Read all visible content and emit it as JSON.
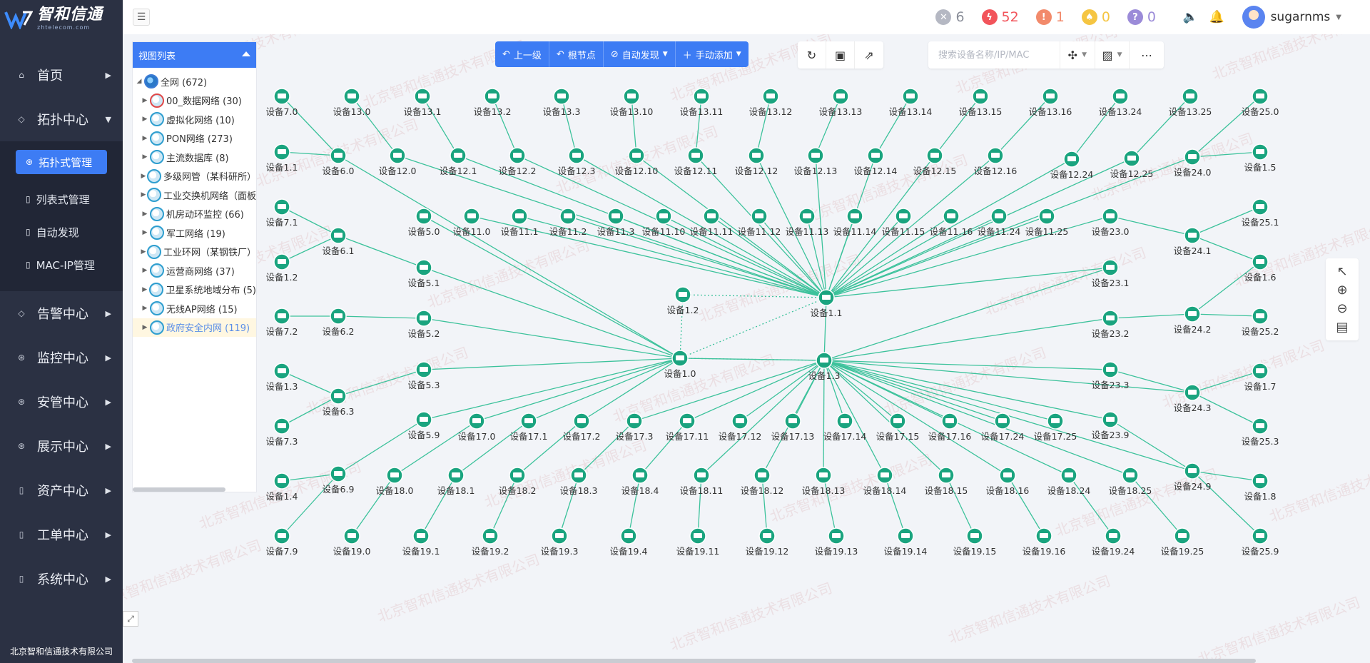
{
  "app": {
    "brand": "智和信通",
    "brand_sub": "zhtelecom.com",
    "company": "北京智和信通技术有限公司",
    "watermark": "北京智和信通技术有限公司"
  },
  "nav": {
    "items": [
      {
        "label": "首页",
        "icon": "home-icon"
      },
      {
        "label": "拓扑中心",
        "icon": "topology-icon",
        "expanded": true
      },
      {
        "label": "告警中心",
        "icon": "alarm-icon"
      },
      {
        "label": "监控中心",
        "icon": "monitor-icon"
      },
      {
        "label": "安管中心",
        "icon": "security-icon"
      },
      {
        "label": "展示中心",
        "icon": "display-icon"
      },
      {
        "label": "资产中心",
        "icon": "asset-icon"
      },
      {
        "label": "工单中心",
        "icon": "ticket-icon"
      },
      {
        "label": "系统中心",
        "icon": "system-icon"
      }
    ],
    "sub_items": [
      {
        "label": "拓扑式管理",
        "active": true
      },
      {
        "label": "列表式管理"
      },
      {
        "label": "自动发现"
      },
      {
        "label": "MAC-IP管理"
      }
    ]
  },
  "header": {
    "badges": [
      {
        "value": "6",
        "color": "#b5b8c3",
        "glyph": "✕"
      },
      {
        "value": "52",
        "color": "#f2545b",
        "glyph": "ϟ"
      },
      {
        "value": "1",
        "color": "#f28a6b",
        "glyph": "!"
      },
      {
        "value": "0",
        "color": "#f5c542",
        "glyph": "♠"
      },
      {
        "value": "0",
        "color": "#9b8bd8",
        "glyph": "?"
      }
    ],
    "username": "sugarnms"
  },
  "view_list": {
    "title": "视图列表",
    "root": "全网 (672)",
    "items": [
      {
        "label": "00_数据网络 (30)",
        "red": true
      },
      {
        "label": "虚拟化网络 (10)"
      },
      {
        "label": "PON网络 (273)"
      },
      {
        "label": "主流数据库 (8)"
      },
      {
        "label": "多级网管（某科研所）"
      },
      {
        "label": "工业交换机网络（面板"
      },
      {
        "label": "机房动环监控 (66)"
      },
      {
        "label": "军工网络 (19)"
      },
      {
        "label": "工业环网（某钢铁厂）"
      },
      {
        "label": "运营商网络 (37)"
      },
      {
        "label": "卫星系统地域分布 (5)"
      },
      {
        "label": "无线AP网络 (15)"
      },
      {
        "label": "政府安全内网 (119)",
        "selected": true
      }
    ]
  },
  "toolbar": {
    "up_level": "上一级",
    "root_node": "根节点",
    "auto_discover": "自动发现",
    "manual_add": "手动添加",
    "search_placeholder": "搜索设备名称/IP/MAC"
  },
  "topology": {
    "core": [
      {
        "name": "设备1.2"
      },
      {
        "name": "设备1.1"
      },
      {
        "name": "设备1.0"
      },
      {
        "name": "设备1.3"
      }
    ],
    "nodes": [
      "设备7.0",
      "设备13.0",
      "设备13.1",
      "设备13.2",
      "设备13.3",
      "设备13.10",
      "设备13.11",
      "设备13.12",
      "设备13.13",
      "设备13.14",
      "设备13.15",
      "设备13.16",
      "设备13.24",
      "设备13.25",
      "设备25.0",
      "设备1.1",
      "设备6.0",
      "设备12.0",
      "设备12.1",
      "设备12.2",
      "设备12.3",
      "设备12.10",
      "设备12.11",
      "设备12.12",
      "设备12.13",
      "设备12.14",
      "设备12.15",
      "设备12.16",
      "设备12.24",
      "设备12.25",
      "设备24.0",
      "设备1.5",
      "设备7.1",
      "设备5.0",
      "设备11.0",
      "设备11.1",
      "设备11.2",
      "设备11.3",
      "设备11.10",
      "设备11.11",
      "设备11.12",
      "设备11.13",
      "设备11.14",
      "设备11.15",
      "设备11.16",
      "设备11.24",
      "设备11.25",
      "设备23.0",
      "设备25.1",
      "设备6.1",
      "设备24.1",
      "设备1.2",
      "设备5.1",
      "设备23.1",
      "设备1.6",
      "设备7.2",
      "设备6.2",
      "设备5.2",
      "设备23.2",
      "设备24.2",
      "设备25.2",
      "设备1.3",
      "设备5.3",
      "设备23.3",
      "设备1.7",
      "设备6.3",
      "设备24.3",
      "设备7.3",
      "设备5.9",
      "设备17.0",
      "设备17.1",
      "设备17.2",
      "设备17.3",
      "设备17.11",
      "设备17.12",
      "设备17.13",
      "设备17.14",
      "设备17.15",
      "设备17.16",
      "设备17.24",
      "设备17.25",
      "设备23.9",
      "设备25.3",
      "设备1.4",
      "设备6.9",
      "设备18.0",
      "设备18.1",
      "设备18.2",
      "设备18.3",
      "设备18.4",
      "设备18.11",
      "设备18.12",
      "设备18.13",
      "设备18.14",
      "设备18.15",
      "设备18.16",
      "设备18.24",
      "设备18.25",
      "设备24.9",
      "设备1.8",
      "设备7.9",
      "设备19.0",
      "设备19.1",
      "设备19.2",
      "设备19.3",
      "设备19.4",
      "设备19.11",
      "设备19.12",
      "设备19.13",
      "设备19.14",
      "设备19.15",
      "设备19.16",
      "设备19.24",
      "设备19.25",
      "设备25.9"
    ],
    "line_color": "#3cc29b",
    "node_color": "#1aa47f"
  }
}
